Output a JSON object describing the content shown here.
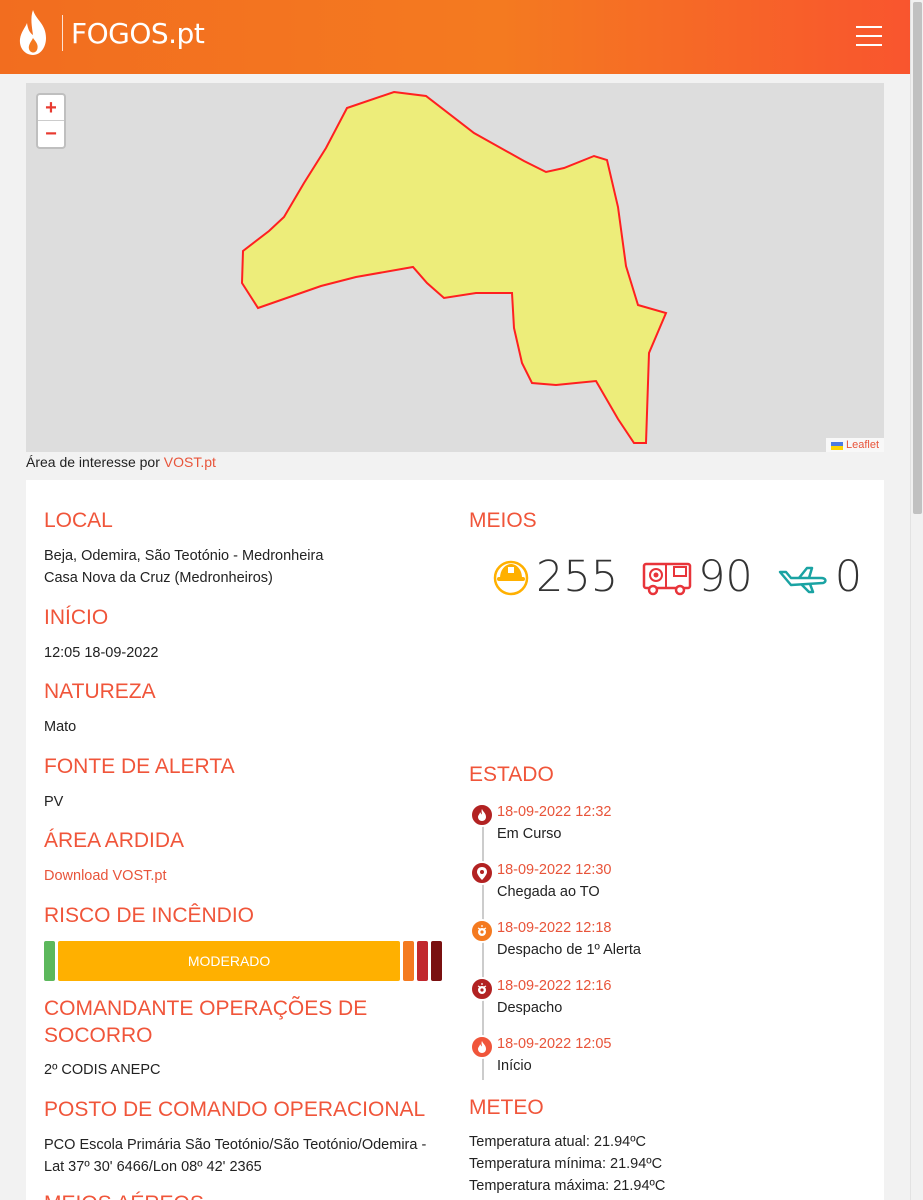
{
  "header": {
    "brand": "FOGOS.pt",
    "logo_icon": "flame-icon",
    "menu_icon": "hamburger-menu-icon",
    "gradient_from": "#f26d1f",
    "gradient_to": "#f9552e"
  },
  "map": {
    "zoom_in": "+",
    "zoom_out": "−",
    "attribution": "Leaflet",
    "polygon_fill": "#eded7a",
    "polygon_stroke": "#ff2020",
    "caption_prefix": "Área de interesse por ",
    "caption_link": "VOST.pt"
  },
  "info": {
    "local_title": "LOCAL",
    "local_line1": "Beja, Odemira, São Teotónio - Medronheira",
    "local_line2": "Casa Nova da Cruz (Medronheiros)",
    "inicio_title": "INÍCIO",
    "inicio_value": "12:05 18-09-2022",
    "natureza_title": "NATUREZA",
    "natureza_value": "Mato",
    "fonte_title": "FONTE DE ALERTA",
    "fonte_value": "PV",
    "area_title": "ÁREA ARDIDA",
    "area_link": "Download VOST.pt",
    "risco_title": "RISCO DE INCÊNDIO",
    "risco_level": "MODERADO",
    "comandante_title_l1": "COMANDANTE OPERAÇÕES DE",
    "comandante_title_l2": "SOCORRO",
    "comandante_value": "2º CODIS ANEPC",
    "posto_title": "POSTO DE COMANDO OPERACIONAL",
    "posto_line1": "PCO Escola Primária São Teotónio/São Teotónio/Odemira -",
    "posto_line2": "Lat 37º 30' 6466/Lon 08º 42' 2365",
    "meios_aereos_title": "MEIOS AÉREOS"
  },
  "risk_colors": {
    "reduzido": "#5cb85c",
    "moderado": "#ffb000",
    "elevado": "#f47a20",
    "muito_elevado": "#c1272d",
    "maximo": "#7a1010"
  },
  "meios": {
    "title": "MEIOS",
    "operacionais": "255",
    "terrestres": "90",
    "aereos": "0",
    "icon_operacionais": "firefighter-helmet-icon",
    "icon_terrestres": "fire-truck-icon",
    "icon_aereos": "airplane-icon"
  },
  "estado": {
    "title": "ESTADO",
    "items": [
      {
        "date": "18-09-2022 12:32",
        "label": "Em Curso",
        "icon": "flame-icon",
        "color": "#b22222"
      },
      {
        "date": "18-09-2022 12:30",
        "label": "Chegada ao TO",
        "icon": "map-pin-icon",
        "color": "#b22222"
      },
      {
        "date": "18-09-2022 12:18",
        "label": "Despacho de 1º Alerta",
        "icon": "siren-icon",
        "color": "#f47a20"
      },
      {
        "date": "18-09-2022 12:16",
        "label": "Despacho",
        "icon": "siren-icon",
        "color": "#b22222"
      },
      {
        "date": "18-09-2022 12:05",
        "label": "Início",
        "icon": "flame-icon",
        "color": "#f0553a"
      }
    ]
  },
  "meteo": {
    "title": "METEO",
    "atual": "Temperatura atual: 21.94ºC",
    "minima": "Temperatura mínima: 21.94ºC",
    "maxima": "Temperatura máxima: 21.94ºC"
  }
}
